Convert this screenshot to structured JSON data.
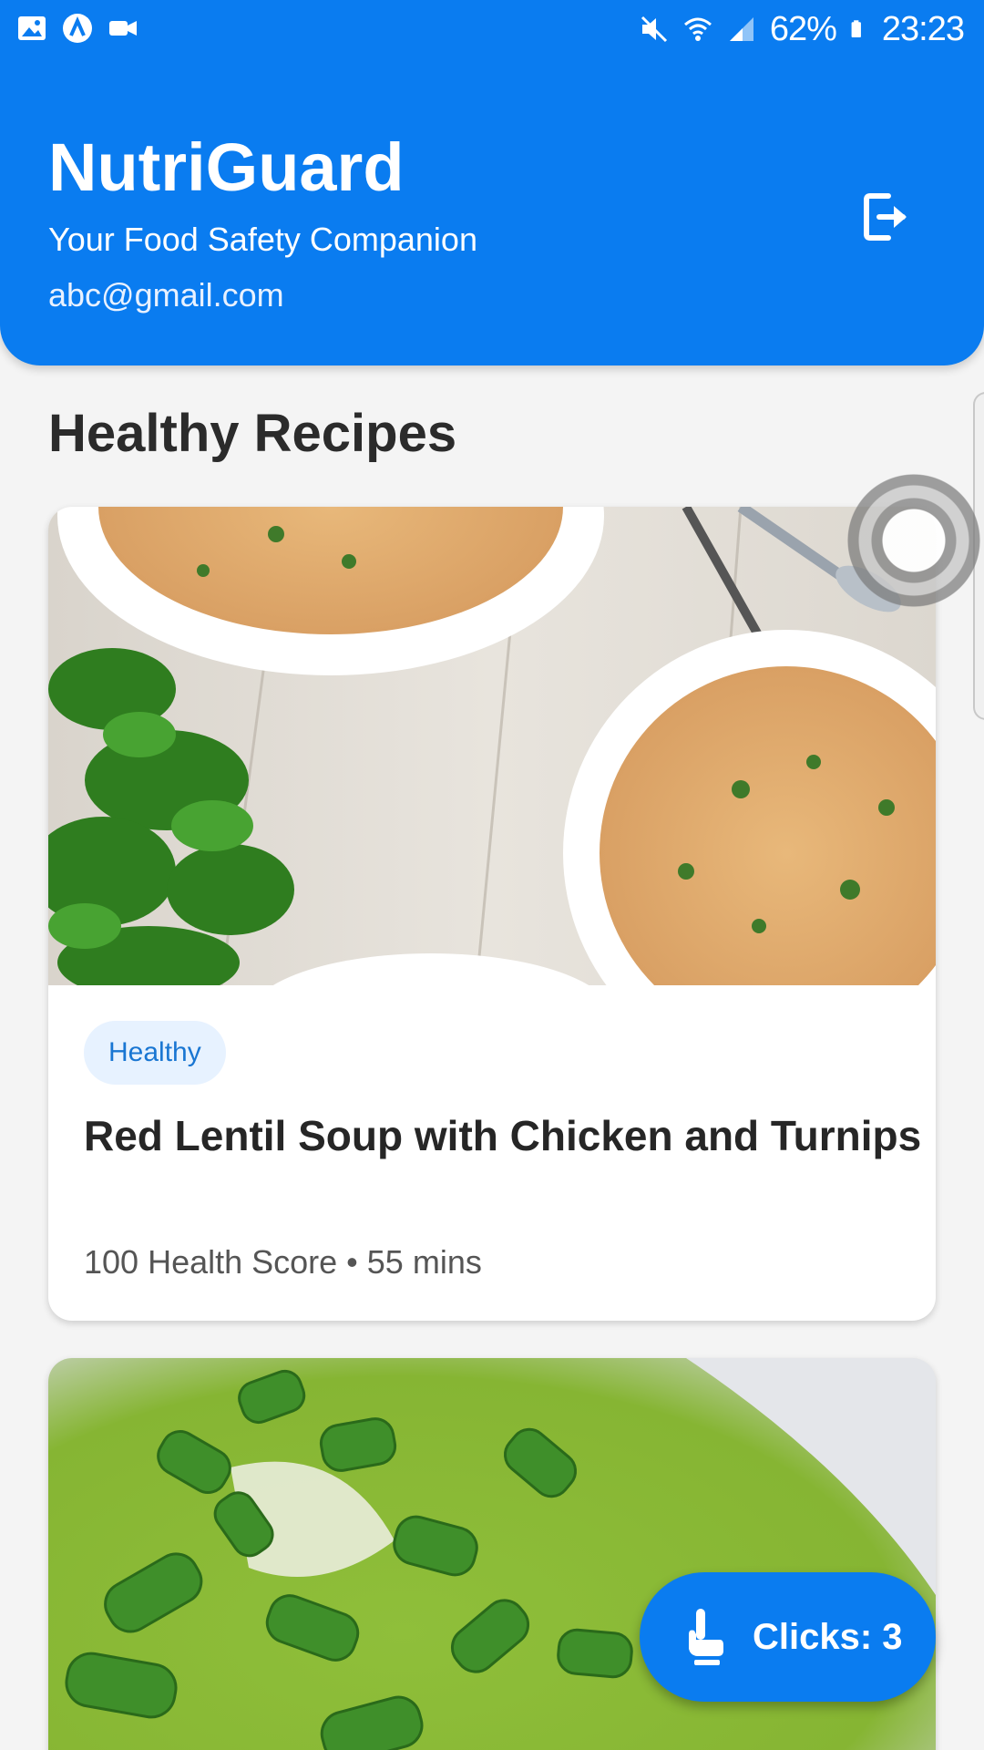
{
  "status_bar": {
    "battery": "62%",
    "time": "23:23"
  },
  "header": {
    "title": "NutriGuard",
    "subtitle": "Your Food Safety Companion",
    "email": "abc@gmail.com",
    "logout_icon": "logout-icon"
  },
  "section": {
    "title": "Healthy Recipes"
  },
  "recipes": [
    {
      "tag": "Healthy",
      "title": "Red Lentil Soup with Chicken and Turnips",
      "meta": "100 Health Score • 55 mins",
      "image": "lentil-soup-photo"
    },
    {
      "image": "green-soup-photo"
    }
  ],
  "fab": {
    "label": "Clicks: 3",
    "icon": "tap-hand-icon"
  },
  "colors": {
    "primary": "#0a7cf0",
    "tag_bg": "#e7f2ff",
    "tag_text": "#1976d2"
  }
}
